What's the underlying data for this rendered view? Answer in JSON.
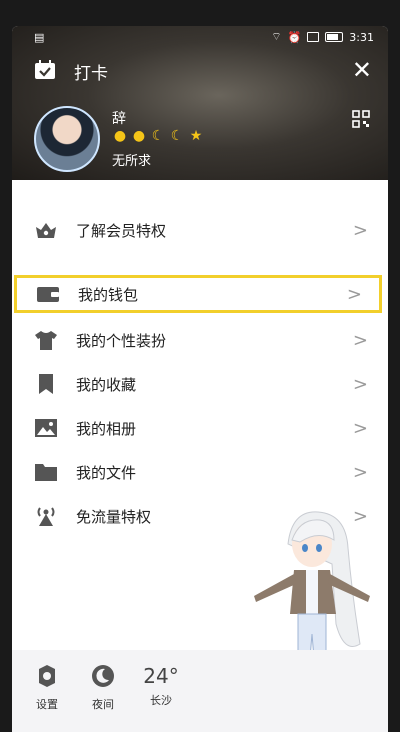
{
  "status_bar": {
    "time": "3:31",
    "icons": [
      "sim-icon",
      "wifi-icon",
      "alarm-icon",
      "vibrate-icon",
      "battery-icon"
    ]
  },
  "header": {
    "checkin_label": "打卡",
    "username": "辞",
    "signature": "无所求",
    "level_icons": [
      "sun",
      "sun",
      "moon",
      "moon",
      "star"
    ]
  },
  "menu": {
    "items": [
      {
        "label": "了解会员特权",
        "icon": "crown-icon"
      },
      {
        "label": "我的钱包",
        "icon": "wallet-icon"
      },
      {
        "label": "我的个性装扮",
        "icon": "shirt-icon"
      },
      {
        "label": "我的收藏",
        "icon": "bookmark-icon"
      },
      {
        "label": "我的相册",
        "icon": "photo-icon"
      },
      {
        "label": "我的文件",
        "icon": "folder-icon"
      },
      {
        "label": "免流量特权",
        "icon": "signal-tower-icon"
      }
    ],
    "arrow": ">"
  },
  "footer": {
    "settings_label": "设置",
    "night_label": "夜间",
    "temperature": "24°",
    "city": "长沙"
  },
  "colors": {
    "highlight": "#f2cf2b",
    "icon": "#555555",
    "level_gold": "#f5c518"
  }
}
